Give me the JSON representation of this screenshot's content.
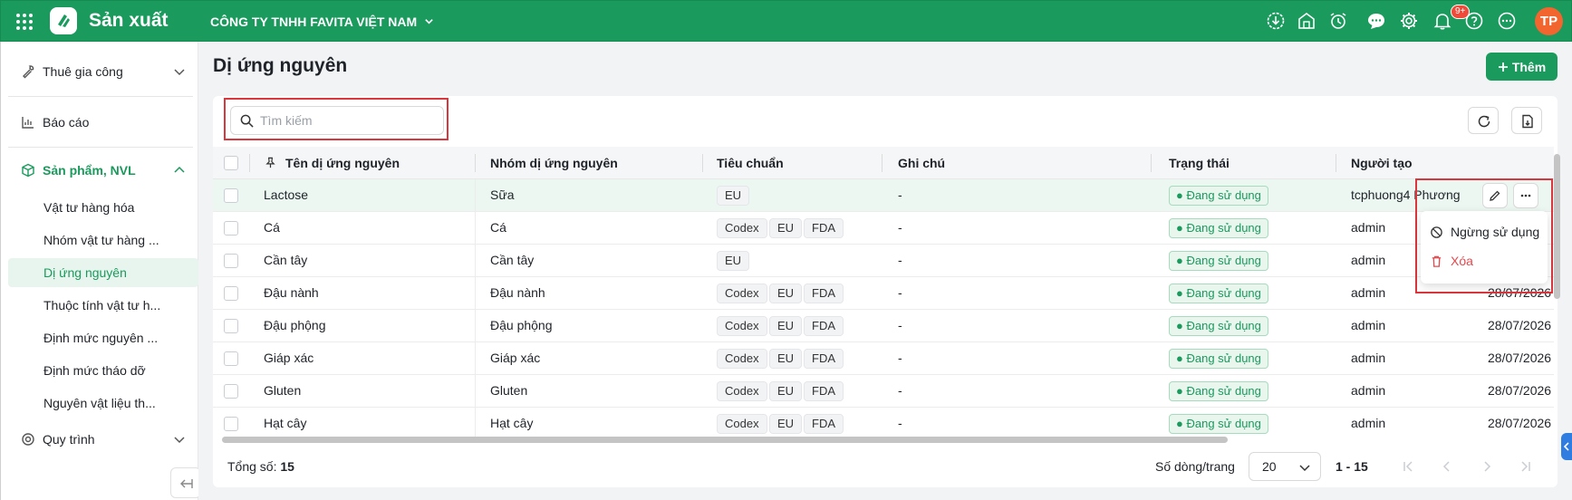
{
  "topbar": {
    "app_name": "Sản xuất",
    "company": "CÔNG TY TNHH FAVITA VIỆT NAM",
    "notification_badge": "9+",
    "avatar_initials": "TP",
    "brand_color": "#1a9a5c"
  },
  "sidebar": {
    "groups": [
      {
        "label": "Thuê gia công",
        "icon": "wrench-icon"
      },
      {
        "label": "Báo cáo",
        "icon": "chart-icon"
      },
      {
        "label": "Sản phẩm, NVL",
        "icon": "box-icon"
      },
      {
        "label": "Quy trình",
        "icon": "process-icon"
      }
    ],
    "items": [
      "Vật tư hàng hóa",
      "Nhóm vật tư hàng ...",
      "Dị ứng nguyên",
      "Thuộc tính vật tư h...",
      "Định mức nguyên ...",
      "Định mức tháo dỡ",
      "Nguyên vật liệu th..."
    ]
  },
  "page": {
    "title": "Dị ứng nguyên",
    "add_label": "Thêm"
  },
  "search": {
    "placeholder": "Tìm kiếm",
    "value": ""
  },
  "table": {
    "columns": [
      "Tên dị ứng nguyên",
      "Nhóm dị ứng nguyên",
      "Tiêu chuẩn",
      "Ghi chú",
      "Trạng thái",
      "Người tạo"
    ],
    "rows": [
      {
        "name": "Lactose",
        "group": "Sữa",
        "standards": [
          "EU"
        ],
        "note": "-",
        "status": "Đang sử dụng",
        "creator": "tcphuong4  Phương",
        "date": ""
      },
      {
        "name": "Cá",
        "group": "Cá",
        "standards": [
          "Codex",
          "EU",
          "FDA"
        ],
        "note": "-",
        "status": "Đang sử dụng",
        "creator": "admin",
        "date": ""
      },
      {
        "name": "Cần tây",
        "group": "Cần tây",
        "standards": [
          "EU"
        ],
        "note": "-",
        "status": "Đang sử dụng",
        "creator": "admin",
        "date": ""
      },
      {
        "name": "Đậu nành",
        "group": "Đậu nành",
        "standards": [
          "Codex",
          "EU",
          "FDA"
        ],
        "note": "-",
        "status": "Đang sử dụng",
        "creator": "admin",
        "date": "28/07/2026"
      },
      {
        "name": "Đậu phộng",
        "group": "Đậu phộng",
        "standards": [
          "Codex",
          "EU",
          "FDA"
        ],
        "note": "-",
        "status": "Đang sử dụng",
        "creator": "admin",
        "date": "28/07/2026"
      },
      {
        "name": "Giáp xác",
        "group": "Giáp xác",
        "standards": [
          "Codex",
          "EU",
          "FDA"
        ],
        "note": "-",
        "status": "Đang sử dụng",
        "creator": "admin",
        "date": "28/07/2026"
      },
      {
        "name": "Gluten",
        "group": "Gluten",
        "standards": [
          "Codex",
          "EU",
          "FDA"
        ],
        "note": "-",
        "status": "Đang sử dụng",
        "creator": "admin",
        "date": "28/07/2026"
      },
      {
        "name": "Hạt cây",
        "group": "Hạt cây",
        "standards": [
          "Codex",
          "EU",
          "FDA"
        ],
        "note": "-",
        "status": "Đang sử dụng",
        "creator": "admin",
        "date": "28/07/2026"
      }
    ]
  },
  "context_menu": {
    "deactivate_label": "Ngừng sử dụng",
    "delete_label": "Xóa",
    "delete_color": "#e5484d"
  },
  "footer": {
    "total_label": "Tổng số:",
    "total_value": "15",
    "rows_per_page_label": "Số dòng/trang",
    "page_size": "20",
    "range": "1 - 15"
  }
}
